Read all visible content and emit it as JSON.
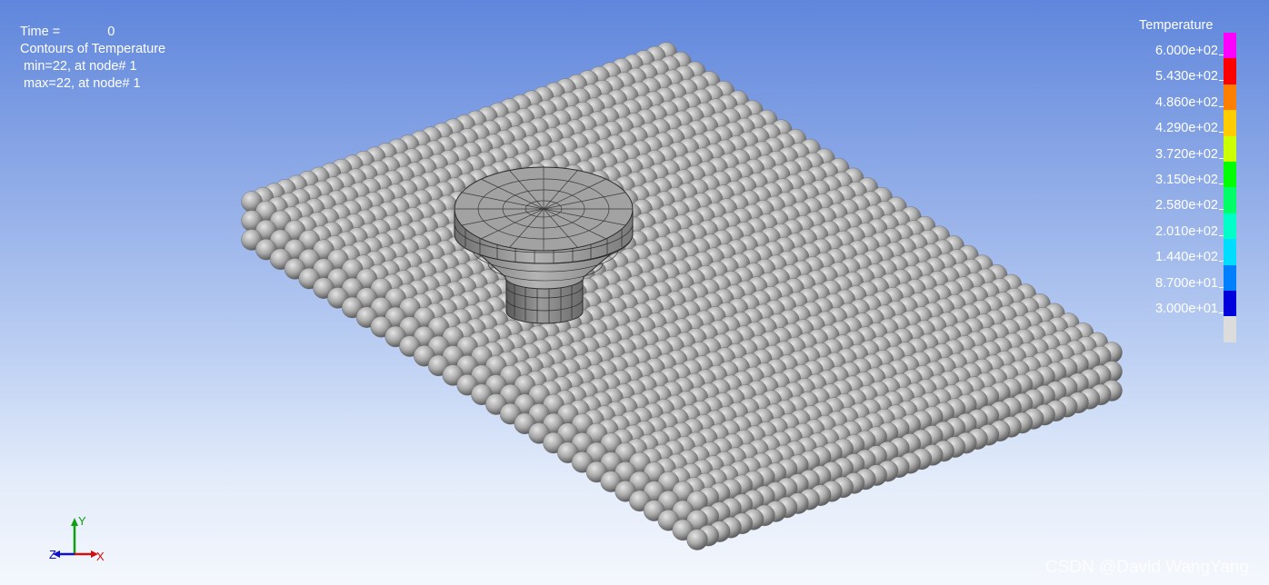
{
  "info": {
    "time_label": "Time =",
    "time_value": "0",
    "line2": "Contours of Temperature",
    "line3": " min=22, at node# 1",
    "line4": " max=22, at node# 1"
  },
  "legend": {
    "title": "Temperature",
    "labels": [
      "6.000e+02",
      "5.430e+02",
      "4.860e+02",
      "4.290e+02",
      "3.720e+02",
      "3.150e+02",
      "2.580e+02",
      "2.010e+02",
      "1.440e+02",
      "8.700e+01",
      "3.000e+01"
    ],
    "colors": [
      "#ff00ff",
      "#ff0000",
      "#ff7f00",
      "#ffcc00",
      "#ccff00",
      "#00ff00",
      "#00ff66",
      "#00ffc8",
      "#00ddff",
      "#0080ff",
      "#0000dd",
      "#dcdcdc"
    ]
  },
  "triad": {
    "x": "X",
    "y": "Y",
    "z": "Z"
  },
  "watermark": "CSDN @David WangYang"
}
